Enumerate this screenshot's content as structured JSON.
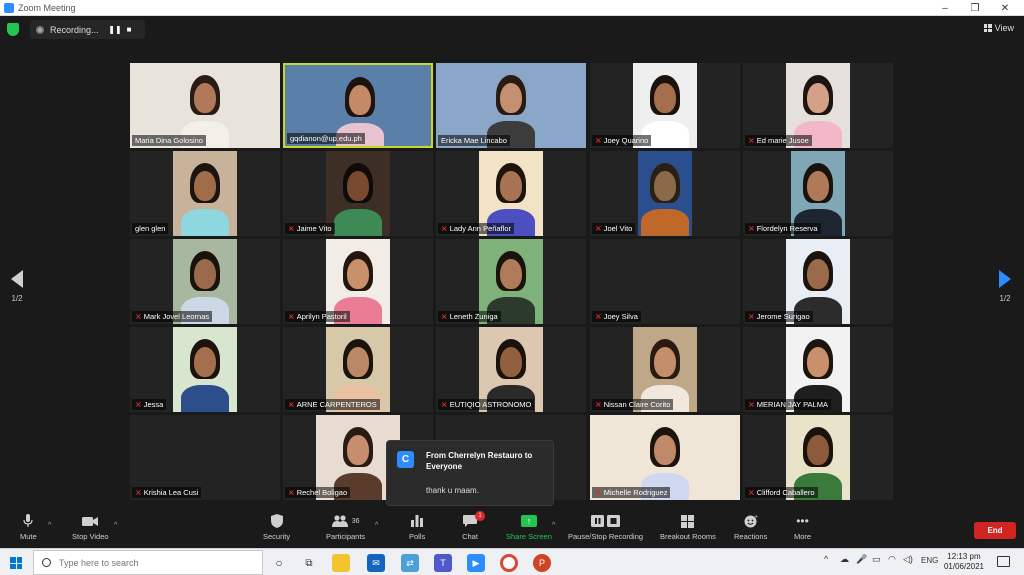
{
  "window": {
    "title": "Zoom Meeting",
    "minimize": "–",
    "maximize": "❐",
    "close": "✕"
  },
  "recording": {
    "label": "Recording...",
    "pause": "❚❚",
    "stop": "■"
  },
  "view": {
    "label": "View"
  },
  "pagination": {
    "left": "1/2",
    "right": "1/2"
  },
  "participants_grid": [
    {
      "name": "Maria Dina Golosino",
      "muted": false
    },
    {
      "name": "gqdianon@up.edu.ph",
      "muted": false
    },
    {
      "name": "Ericka Mae Lincabo",
      "muted": false
    },
    {
      "name": "Joey Quarino",
      "muted": true
    },
    {
      "name": "Ed marie Jusoe",
      "muted": true
    },
    {
      "name": "glen glen",
      "muted": false
    },
    {
      "name": "Jaime Vito",
      "muted": true
    },
    {
      "name": "Lady Ann Peñaflor",
      "muted": true
    },
    {
      "name": "Joel Vito",
      "muted": true
    },
    {
      "name": "Flordelyn Reserva",
      "muted": true
    },
    {
      "name": "Mark Jovel Leornas",
      "muted": true
    },
    {
      "name": "Aprilyn Pastoril",
      "muted": true
    },
    {
      "name": "Leneth Zuniga",
      "muted": true
    },
    {
      "name": "Joey Silva",
      "muted": true
    },
    {
      "name": "Jerome Surigao",
      "muted": true
    },
    {
      "name": "Jessa",
      "muted": true
    },
    {
      "name": "ARNE CARPENTEROS",
      "muted": true
    },
    {
      "name": "EUTIQIO ASTRONOMO",
      "muted": true
    },
    {
      "name": "Nissan Claire Corito",
      "muted": true
    },
    {
      "name": "MERIAN JAY PALMA",
      "muted": true
    },
    {
      "name": "Krishia Lea Cusi",
      "muted": true
    },
    {
      "name": "Rechel Boligao",
      "muted": true
    },
    {
      "name": "",
      "muted": false
    },
    {
      "name": "Michelle Rodriguez",
      "muted": true
    },
    {
      "name": "Clifford Caballero",
      "muted": true
    }
  ],
  "chat_toast": {
    "avatar_letter": "C",
    "from": "From Cherrelyn Restauro to Everyone",
    "message": "thank u maam."
  },
  "toolbar": {
    "mute": "Mute",
    "stop_video": "Stop Video",
    "security": "Security",
    "participants": "Participants",
    "participants_count": "36",
    "polls": "Polls",
    "chat": "Chat",
    "chat_badge": "1",
    "share_screen": "Share Screen",
    "pause_stop_recording": "Pause/Stop Recording",
    "breakout_rooms": "Breakout Rooms",
    "reactions": "Reactions",
    "more": "More",
    "end": "End"
  },
  "taskbar": {
    "search_placeholder": "Type here to search",
    "language": "ENG",
    "time": "12:13 pm",
    "date": "01/06/2021"
  },
  "colors": {
    "accent_blue": "#2d8cff",
    "active_speaker": "#c6d82a",
    "share_green": "#23c552",
    "end_red": "#d32424",
    "muted_red": "#e02828"
  }
}
